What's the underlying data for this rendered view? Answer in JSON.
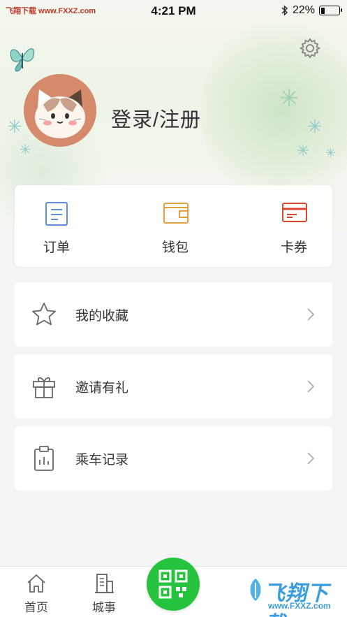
{
  "status_bar": {
    "carrier": "飞翔下载 www.FXXZ.com",
    "time": "4:21 PM",
    "battery": "22%",
    "battery_level": 0.22
  },
  "profile": {
    "login_label": "登录/注册"
  },
  "quick_actions": [
    {
      "label": "订单",
      "icon": "order-icon",
      "color": "#5b8fe0"
    },
    {
      "label": "钱包",
      "icon": "wallet-icon",
      "color": "#e0a13e"
    },
    {
      "label": "卡券",
      "icon": "coupon-icon",
      "color": "#d9452f"
    }
  ],
  "menu": [
    {
      "label": "我的收藏",
      "icon": "star-icon"
    },
    {
      "label": "邀请有礼",
      "icon": "gift-icon"
    },
    {
      "label": "乘车记录",
      "icon": "clipboard-icon"
    }
  ],
  "tabbar": {
    "tabs": [
      {
        "label": "首页",
        "icon": "home-icon"
      },
      {
        "label": "城事",
        "icon": "building-icon"
      }
    ],
    "center": {
      "icon": "qr-scan-icon",
      "color": "#26c33e"
    }
  },
  "watermark": {
    "text": "飞翔下载",
    "url": "www.FXXZ.com"
  }
}
